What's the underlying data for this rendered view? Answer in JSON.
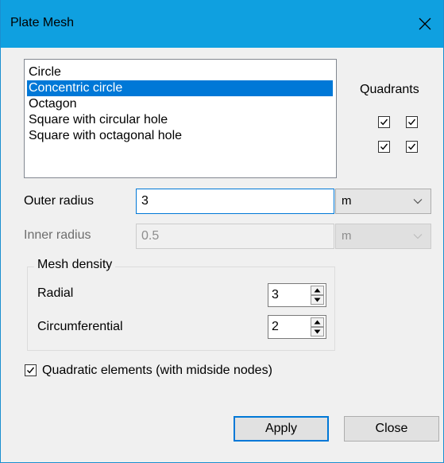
{
  "window": {
    "title": "Plate Mesh"
  },
  "shapes": {
    "items": [
      "Circle",
      "Concentric circle",
      "Octagon",
      "Square with circular hole",
      "Square with octagonal hole"
    ],
    "selected": "Concentric circle"
  },
  "quadrants": {
    "label": "Quadrants",
    "checked": [
      true,
      true,
      true,
      true
    ]
  },
  "outer_radius": {
    "label": "Outer radius",
    "value": "3",
    "unit": "m"
  },
  "inner_radius": {
    "label": "Inner radius",
    "value": "0.5",
    "unit": "m",
    "enabled": false
  },
  "mesh_density": {
    "title": "Mesh density",
    "radial": {
      "label": "Radial",
      "value": "3"
    },
    "circumferential": {
      "label": "Circumferential",
      "value": "2"
    }
  },
  "quadratic": {
    "label": "Quadratic elements (with midside nodes)",
    "checked": true
  },
  "buttons": {
    "apply": "Apply",
    "close": "Close"
  },
  "icons": {
    "close": "close-icon",
    "dropdown": "chevron-down-icon",
    "spin_up": "spin-up-icon",
    "spin_down": "spin-down-icon",
    "check": "check-icon"
  },
  "colors": {
    "titlebar": "#0fa0e0",
    "selection": "#0078d7",
    "window_bg": "#f0f0f0"
  }
}
